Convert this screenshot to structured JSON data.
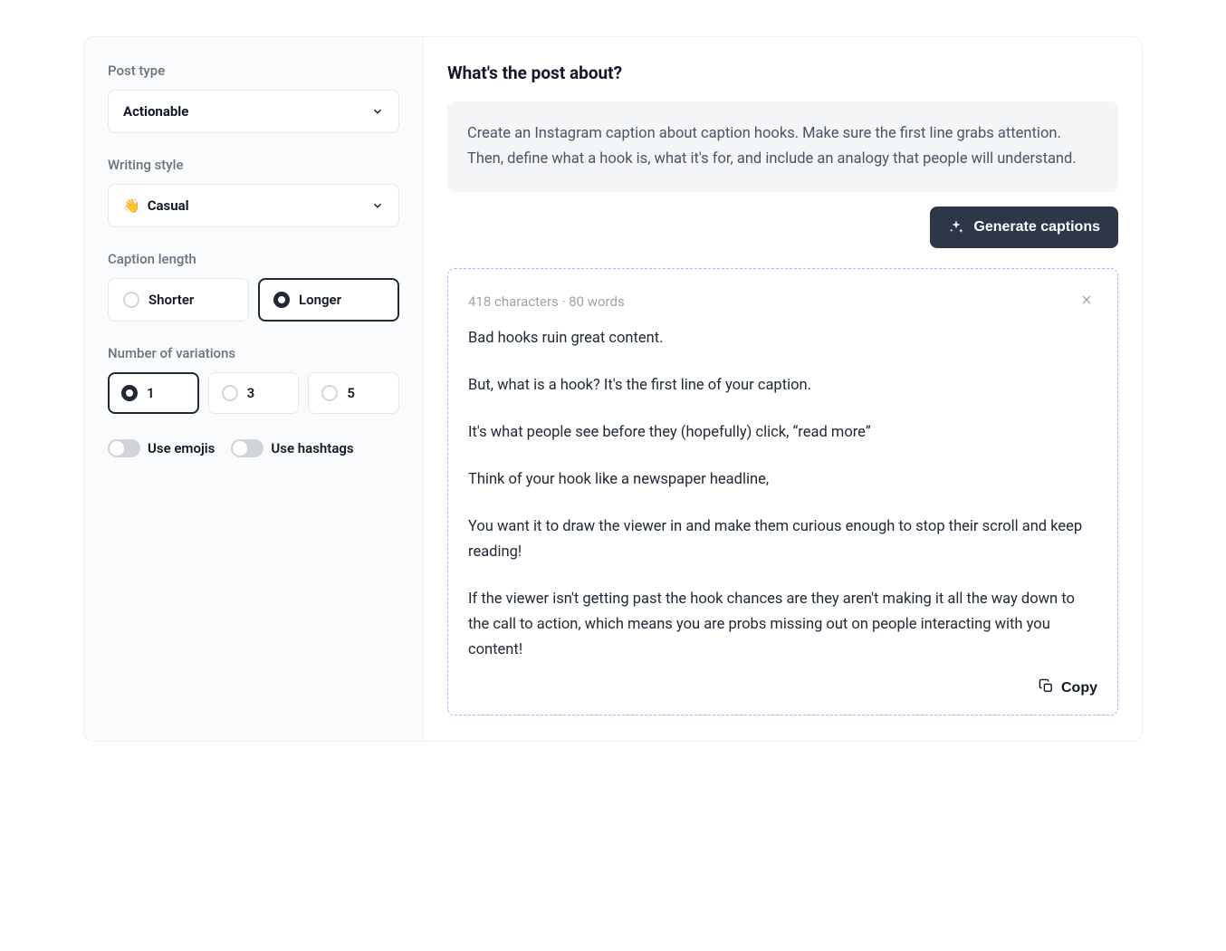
{
  "sidebar": {
    "post_type": {
      "label": "Post type",
      "value": "Actionable"
    },
    "writing_style": {
      "label": "Writing style",
      "emoji": "👋",
      "value": "Casual"
    },
    "caption_length": {
      "label": "Caption length",
      "options": [
        "Shorter",
        "Longer"
      ],
      "selected": "Longer"
    },
    "variations": {
      "label": "Number of variations",
      "options": [
        "1",
        "3",
        "5"
      ],
      "selected": "1"
    },
    "toggles": {
      "emojis": {
        "label": "Use emojis",
        "on": false
      },
      "hashtags": {
        "label": "Use hashtags",
        "on": false
      }
    }
  },
  "main": {
    "heading": "What's the post about?",
    "prompt": "Create an Instagram caption about caption hooks. Make sure the first line grabs attention. Then, define what a hook is, what it's for, and include an analogy that people will understand.",
    "generate_label": "Generate captions",
    "result": {
      "meta": "418 characters · 80 words",
      "paragraphs": [
        "Bad hooks ruin great content.",
        "But, what is a hook? It's the first line of your caption.",
        "It's what people see before they (hopefully) click, “read more”",
        "Think of your hook like a newspaper headline,",
        "You want it to draw the viewer in and make them curious enough to stop their scroll and keep reading!",
        "If the viewer isn't getting past the hook chances are they aren't making it all the way down to the call to action, which means you are probs missing out on people interacting with you content!"
      ],
      "copy_label": "Copy"
    }
  }
}
